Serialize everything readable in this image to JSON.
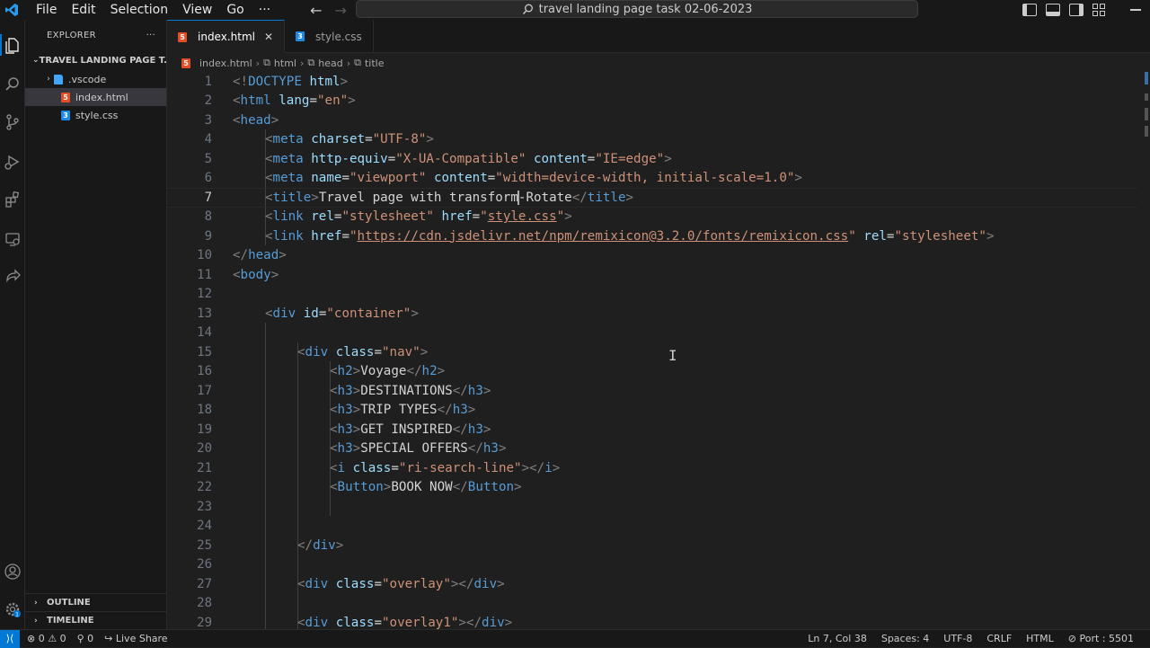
{
  "titlebar": {
    "menu": [
      "File",
      "Edit",
      "Selection",
      "View",
      "Go",
      "···"
    ],
    "search_text": "travel landing page task 02-06-2023"
  },
  "sidebar": {
    "title": "EXPLORER",
    "more": "···",
    "folder": "TRAVEL LANDING PAGE T...",
    "items": [
      {
        "label": ".vscode",
        "type": "folder"
      },
      {
        "label": "index.html",
        "type": "html"
      },
      {
        "label": "style.css",
        "type": "css"
      }
    ],
    "outline": "OUTLINE",
    "timeline": "TIMELINE"
  },
  "tabs": [
    {
      "label": "index.html",
      "active": true,
      "icon": "html-file-icon"
    },
    {
      "label": "style.css",
      "active": false,
      "icon": "css-file-icon"
    }
  ],
  "breadcrumb": [
    "index.html",
    "html",
    "head",
    "title"
  ],
  "editor": {
    "current_line": 7,
    "lines": [
      {
        "n": "1",
        "indent": 0,
        "parts": [
          [
            "punc",
            "<!"
          ],
          [
            "kw",
            "DOCTYPE"
          ],
          [
            "txt",
            " "
          ],
          [
            "attr",
            "html"
          ],
          [
            "punc",
            ">"
          ]
        ]
      },
      {
        "n": "2",
        "indent": 0,
        "parts": [
          [
            "punc",
            "<"
          ],
          [
            "tag",
            "html"
          ],
          [
            "txt",
            " "
          ],
          [
            "attr",
            "lang"
          ],
          [
            "txt",
            "="
          ],
          [
            "str",
            "\"en\""
          ],
          [
            "punc",
            ">"
          ]
        ]
      },
      {
        "n": "3",
        "indent": 0,
        "parts": [
          [
            "punc",
            "<"
          ],
          [
            "tag",
            "head"
          ],
          [
            "punc",
            ">"
          ]
        ]
      },
      {
        "n": "4",
        "indent": 1,
        "parts": [
          [
            "punc",
            "<"
          ],
          [
            "tag",
            "meta"
          ],
          [
            "txt",
            " "
          ],
          [
            "attr",
            "charset"
          ],
          [
            "txt",
            "="
          ],
          [
            "str",
            "\"UTF-8\""
          ],
          [
            "punc",
            ">"
          ]
        ]
      },
      {
        "n": "5",
        "indent": 1,
        "parts": [
          [
            "punc",
            "<"
          ],
          [
            "tag",
            "meta"
          ],
          [
            "txt",
            " "
          ],
          [
            "attr",
            "http-equiv"
          ],
          [
            "txt",
            "="
          ],
          [
            "str",
            "\"X-UA-Compatible\""
          ],
          [
            "txt",
            " "
          ],
          [
            "attr",
            "content"
          ],
          [
            "txt",
            "="
          ],
          [
            "str",
            "\"IE=edge\""
          ],
          [
            "punc",
            ">"
          ]
        ]
      },
      {
        "n": "6",
        "indent": 1,
        "parts": [
          [
            "punc",
            "<"
          ],
          [
            "tag",
            "meta"
          ],
          [
            "txt",
            " "
          ],
          [
            "attr",
            "name"
          ],
          [
            "txt",
            "="
          ],
          [
            "str",
            "\"viewport\""
          ],
          [
            "txt",
            " "
          ],
          [
            "attr",
            "content"
          ],
          [
            "txt",
            "="
          ],
          [
            "str",
            "\"width=device-width, initial-scale=1.0\""
          ],
          [
            "punc",
            ">"
          ]
        ]
      },
      {
        "n": "7",
        "indent": 1,
        "parts": [
          [
            "punc",
            "<"
          ],
          [
            "tag",
            "title"
          ],
          [
            "punc",
            ">"
          ],
          [
            "txt",
            "Travel page with transform"
          ],
          [
            "cursor",
            ""
          ],
          [
            "txt",
            "-Rotate"
          ],
          [
            "punc",
            "</"
          ],
          [
            "tag",
            "title"
          ],
          [
            "punc",
            ">"
          ]
        ]
      },
      {
        "n": "8",
        "indent": 1,
        "parts": [
          [
            "punc",
            "<"
          ],
          [
            "tag",
            "link"
          ],
          [
            "txt",
            " "
          ],
          [
            "attr",
            "rel"
          ],
          [
            "txt",
            "="
          ],
          [
            "str",
            "\"stylesheet\""
          ],
          [
            "txt",
            " "
          ],
          [
            "attr",
            "href"
          ],
          [
            "txt",
            "="
          ],
          [
            "str",
            "\""
          ],
          [
            "link",
            "style.css"
          ],
          [
            "str",
            "\""
          ],
          [
            "punc",
            ">"
          ]
        ]
      },
      {
        "n": "9",
        "indent": 1,
        "parts": [
          [
            "punc",
            "<"
          ],
          [
            "tag",
            "link"
          ],
          [
            "txt",
            " "
          ],
          [
            "attr",
            "href"
          ],
          [
            "txt",
            "="
          ],
          [
            "str",
            "\""
          ],
          [
            "link",
            "https://cdn.jsdelivr.net/npm/remixicon@3.2.0/fonts/remixicon.css"
          ],
          [
            "str",
            "\""
          ],
          [
            "txt",
            " "
          ],
          [
            "attr",
            "rel"
          ],
          [
            "txt",
            "="
          ],
          [
            "str",
            "\"stylesheet\""
          ],
          [
            "punc",
            ">"
          ]
        ]
      },
      {
        "n": "10",
        "indent": 0,
        "parts": [
          [
            "punc",
            "</"
          ],
          [
            "tag",
            "head"
          ],
          [
            "punc",
            ">"
          ]
        ]
      },
      {
        "n": "11",
        "indent": 0,
        "parts": [
          [
            "punc",
            "<"
          ],
          [
            "tag",
            "body"
          ],
          [
            "punc",
            ">"
          ]
        ]
      },
      {
        "n": "12",
        "indent": 0,
        "parts": []
      },
      {
        "n": "13",
        "indent": 1,
        "parts": [
          [
            "punc",
            "<"
          ],
          [
            "tag",
            "div"
          ],
          [
            "txt",
            " "
          ],
          [
            "attr",
            "id"
          ],
          [
            "txt",
            "="
          ],
          [
            "str",
            "\"container\""
          ],
          [
            "punc",
            ">"
          ]
        ]
      },
      {
        "n": "14",
        "indent": 0,
        "parts": []
      },
      {
        "n": "15",
        "indent": 2,
        "parts": [
          [
            "punc",
            "<"
          ],
          [
            "tag",
            "div"
          ],
          [
            "txt",
            " "
          ],
          [
            "attr",
            "class"
          ],
          [
            "txt",
            "="
          ],
          [
            "str",
            "\"nav\""
          ],
          [
            "punc",
            ">"
          ]
        ]
      },
      {
        "n": "16",
        "indent": 3,
        "parts": [
          [
            "punc",
            "<"
          ],
          [
            "tag",
            "h2"
          ],
          [
            "punc",
            ">"
          ],
          [
            "txt",
            "Voyage"
          ],
          [
            "punc",
            "</"
          ],
          [
            "tag",
            "h2"
          ],
          [
            "punc",
            ">"
          ]
        ]
      },
      {
        "n": "17",
        "indent": 3,
        "parts": [
          [
            "punc",
            "<"
          ],
          [
            "tag",
            "h3"
          ],
          [
            "punc",
            ">"
          ],
          [
            "txt",
            "DESTINATIONS"
          ],
          [
            "punc",
            "</"
          ],
          [
            "tag",
            "h3"
          ],
          [
            "punc",
            ">"
          ]
        ]
      },
      {
        "n": "18",
        "indent": 3,
        "parts": [
          [
            "punc",
            "<"
          ],
          [
            "tag",
            "h3"
          ],
          [
            "punc",
            ">"
          ],
          [
            "txt",
            "TRIP TYPES"
          ],
          [
            "punc",
            "</"
          ],
          [
            "tag",
            "h3"
          ],
          [
            "punc",
            ">"
          ]
        ]
      },
      {
        "n": "19",
        "indent": 3,
        "parts": [
          [
            "punc",
            "<"
          ],
          [
            "tag",
            "h3"
          ],
          [
            "punc",
            ">"
          ],
          [
            "txt",
            "GET INSPIRED"
          ],
          [
            "punc",
            "</"
          ],
          [
            "tag",
            "h3"
          ],
          [
            "punc",
            ">"
          ]
        ]
      },
      {
        "n": "20",
        "indent": 3,
        "parts": [
          [
            "punc",
            "<"
          ],
          [
            "tag",
            "h3"
          ],
          [
            "punc",
            ">"
          ],
          [
            "txt",
            "SPECIAL OFFERS"
          ],
          [
            "punc",
            "</"
          ],
          [
            "tag",
            "h3"
          ],
          [
            "punc",
            ">"
          ]
        ]
      },
      {
        "n": "21",
        "indent": 3,
        "parts": [
          [
            "punc",
            "<"
          ],
          [
            "tag",
            "i"
          ],
          [
            "txt",
            " "
          ],
          [
            "attr",
            "class"
          ],
          [
            "txt",
            "="
          ],
          [
            "str",
            "\"ri-search-line\""
          ],
          [
            "punc",
            "></"
          ],
          [
            "tag",
            "i"
          ],
          [
            "punc",
            ">"
          ]
        ]
      },
      {
        "n": "22",
        "indent": 3,
        "parts": [
          [
            "punc",
            "<"
          ],
          [
            "tag",
            "Button"
          ],
          [
            "punc",
            ">"
          ],
          [
            "txt",
            "BOOK NOW"
          ],
          [
            "punc",
            "</"
          ],
          [
            "tag",
            "Button"
          ],
          [
            "punc",
            ">"
          ]
        ]
      },
      {
        "n": "23",
        "indent": 0,
        "parts": []
      },
      {
        "n": "24",
        "indent": 0,
        "parts": []
      },
      {
        "n": "25",
        "indent": 2,
        "parts": [
          [
            "punc",
            "</"
          ],
          [
            "tag",
            "div"
          ],
          [
            "punc",
            ">"
          ]
        ]
      },
      {
        "n": "26",
        "indent": 0,
        "parts": []
      },
      {
        "n": "27",
        "indent": 2,
        "parts": [
          [
            "punc",
            "<"
          ],
          [
            "tag",
            "div"
          ],
          [
            "txt",
            " "
          ],
          [
            "attr",
            "class"
          ],
          [
            "txt",
            "="
          ],
          [
            "str",
            "\"overlay\""
          ],
          [
            "punc",
            "></"
          ],
          [
            "tag",
            "div"
          ],
          [
            "punc",
            ">"
          ]
        ]
      },
      {
        "n": "28",
        "indent": 0,
        "parts": []
      },
      {
        "n": "29",
        "indent": 2,
        "parts": [
          [
            "punc",
            "<"
          ],
          [
            "tag",
            "div"
          ],
          [
            "txt",
            " "
          ],
          [
            "attr",
            "class"
          ],
          [
            "txt",
            "="
          ],
          [
            "str",
            "\"overlay1\""
          ],
          [
            "punc",
            "></"
          ],
          [
            "tag",
            "div"
          ],
          [
            "punc",
            ">"
          ]
        ]
      }
    ]
  },
  "statusbar": {
    "errors": "0",
    "warnings": "0",
    "ports": "0",
    "live_share": "Live Share",
    "position": "Ln 7, Col 38",
    "spaces": "Spaces: 4",
    "encoding": "UTF-8",
    "eol": "CRLF",
    "language": "HTML",
    "port": "Port : 5501"
  },
  "colors": {
    "accent": "#0078d4",
    "background": "#1f1f1f"
  }
}
